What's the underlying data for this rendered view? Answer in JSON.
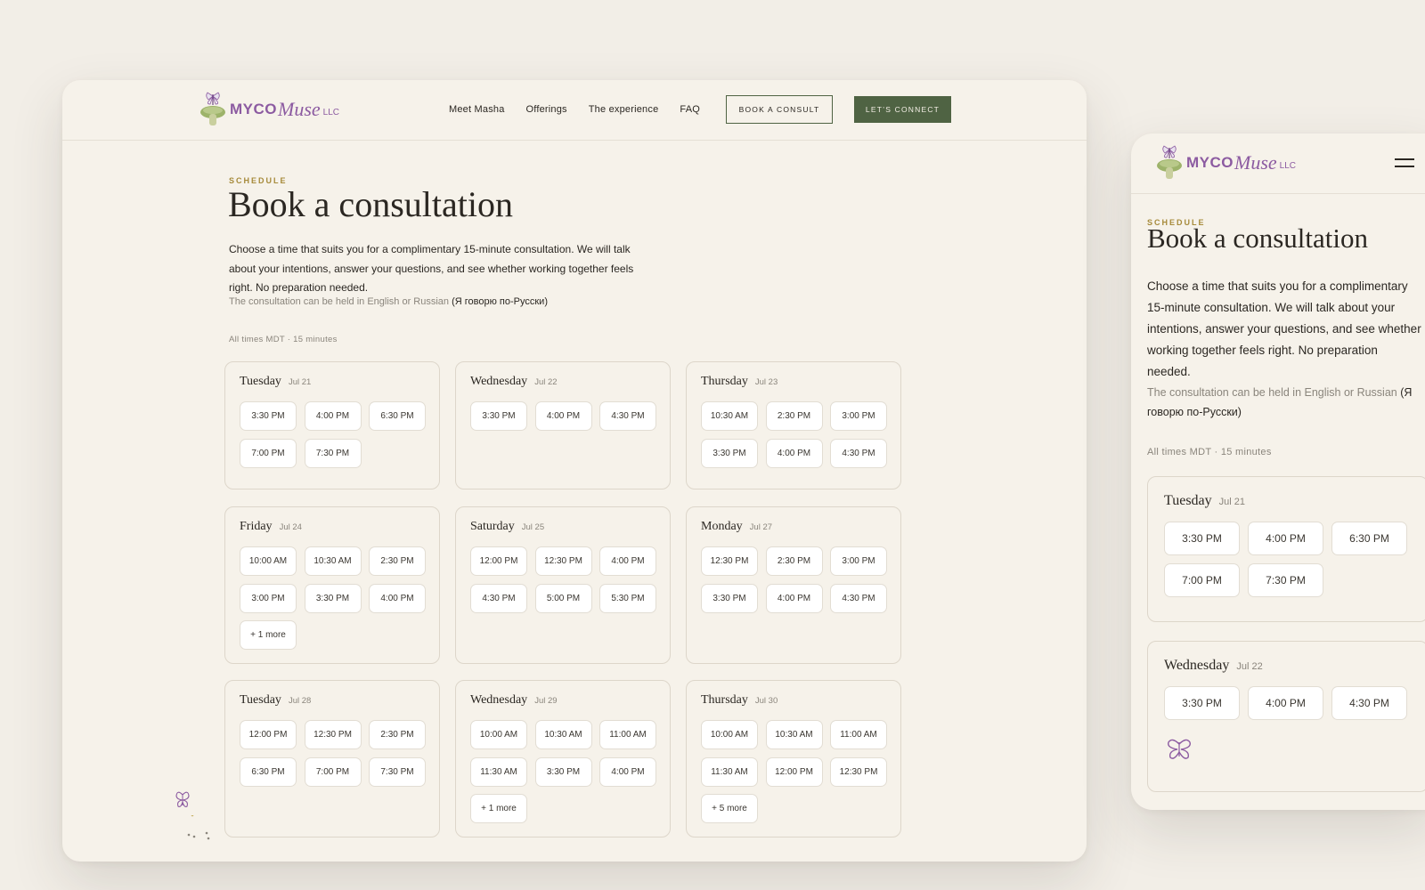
{
  "brand": {
    "myco": "MYCO",
    "muse": "Muse",
    "llc": "LLC",
    "colors": {
      "accent": "#4f6343",
      "brand_purple": "#8c5ba1",
      "eyebrow": "#a68a3a",
      "background": "#f6f2ea"
    }
  },
  "nav": {
    "items": [
      "Meet Masha",
      "Offerings",
      "The experience",
      "FAQ"
    ],
    "book_consult": "BOOK A CONSULT",
    "lets_connect": "LET’S CONNECT"
  },
  "page": {
    "eyebrow": "SCHEDULE",
    "title": "Book a consultation",
    "intro": "Choose a time that suits you for a complimentary 15-minute consultation. We will talk about your intentions, answer your questions, and see whether working together feels right. No preparation needed.",
    "language_note": "The consultation can be held in English or Russian",
    "language_ru": "(Я говорю по-Русски)",
    "meta": "All times MDT · 15 minutes"
  },
  "days": [
    {
      "name": "Tuesday",
      "date": "Jul 21",
      "slots": [
        "3:30 PM",
        "4:00 PM",
        "6:30 PM",
        "7:00 PM",
        "7:30 PM"
      ],
      "more": ""
    },
    {
      "name": "Wednesday",
      "date": "Jul 22",
      "slots": [
        "3:30 PM",
        "4:00 PM",
        "4:30 PM"
      ],
      "more": ""
    },
    {
      "name": "Thursday",
      "date": "Jul 23",
      "slots": [
        "10:30 AM",
        "2:30 PM",
        "3:00 PM",
        "3:30 PM",
        "4:00 PM",
        "4:30 PM"
      ],
      "more": ""
    },
    {
      "name": "Friday",
      "date": "Jul 24",
      "slots": [
        "10:00 AM",
        "10:30 AM",
        "2:30 PM",
        "3:00 PM",
        "3:30 PM",
        "4:00 PM"
      ],
      "more": "+ 1 more"
    },
    {
      "name": "Saturday",
      "date": "Jul 25",
      "slots": [
        "12:00 PM",
        "12:30 PM",
        "4:00 PM",
        "4:30 PM",
        "5:00 PM",
        "5:30 PM"
      ],
      "more": ""
    },
    {
      "name": "Monday",
      "date": "Jul 27",
      "slots": [
        "12:30 PM",
        "2:30 PM",
        "3:00 PM",
        "3:30 PM",
        "4:00 PM",
        "4:30 PM"
      ],
      "more": ""
    },
    {
      "name": "Tuesday",
      "date": "Jul 28",
      "slots": [
        "12:00 PM",
        "12:30 PM",
        "2:30 PM",
        "6:30 PM",
        "7:00 PM",
        "7:30 PM"
      ],
      "more": ""
    },
    {
      "name": "Wednesday",
      "date": "Jul 29",
      "slots": [
        "10:00 AM",
        "10:30 AM",
        "11:00 AM",
        "11:30 AM",
        "3:30 PM",
        "4:00 PM"
      ],
      "more": "+ 1 more"
    },
    {
      "name": "Thursday",
      "date": "Jul 30",
      "slots": [
        "10:00 AM",
        "10:30 AM",
        "11:00 AM",
        "11:30 AM",
        "12:00 PM",
        "12:30 PM"
      ],
      "more": "+ 5 more"
    }
  ],
  "mobile_days": [
    {
      "name": "Tuesday",
      "date": "Jul 21",
      "slots": [
        "3:30 PM",
        "4:00 PM",
        "6:30 PM",
        "7:00 PM",
        "7:30 PM"
      ]
    },
    {
      "name": "Wednesday",
      "date": "Jul 22",
      "slots": [
        "3:30 PM",
        "4:00 PM",
        "4:30 PM"
      ]
    }
  ],
  "icons": {
    "logo": "mushroom-butterfly-logo-icon",
    "menu": "hamburger-menu-icon",
    "butterfly": "butterfly-icon"
  }
}
